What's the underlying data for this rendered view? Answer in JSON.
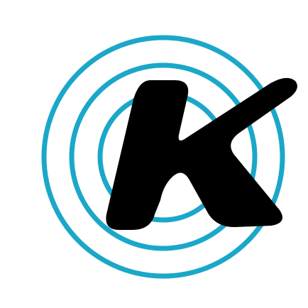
{
  "logo": {
    "icon": "k-letter-rings-logo",
    "ring_color": "#1ba7c9",
    "letter_color": "#000000",
    "background_color": "#ffffff",
    "ring_count": 3
  }
}
